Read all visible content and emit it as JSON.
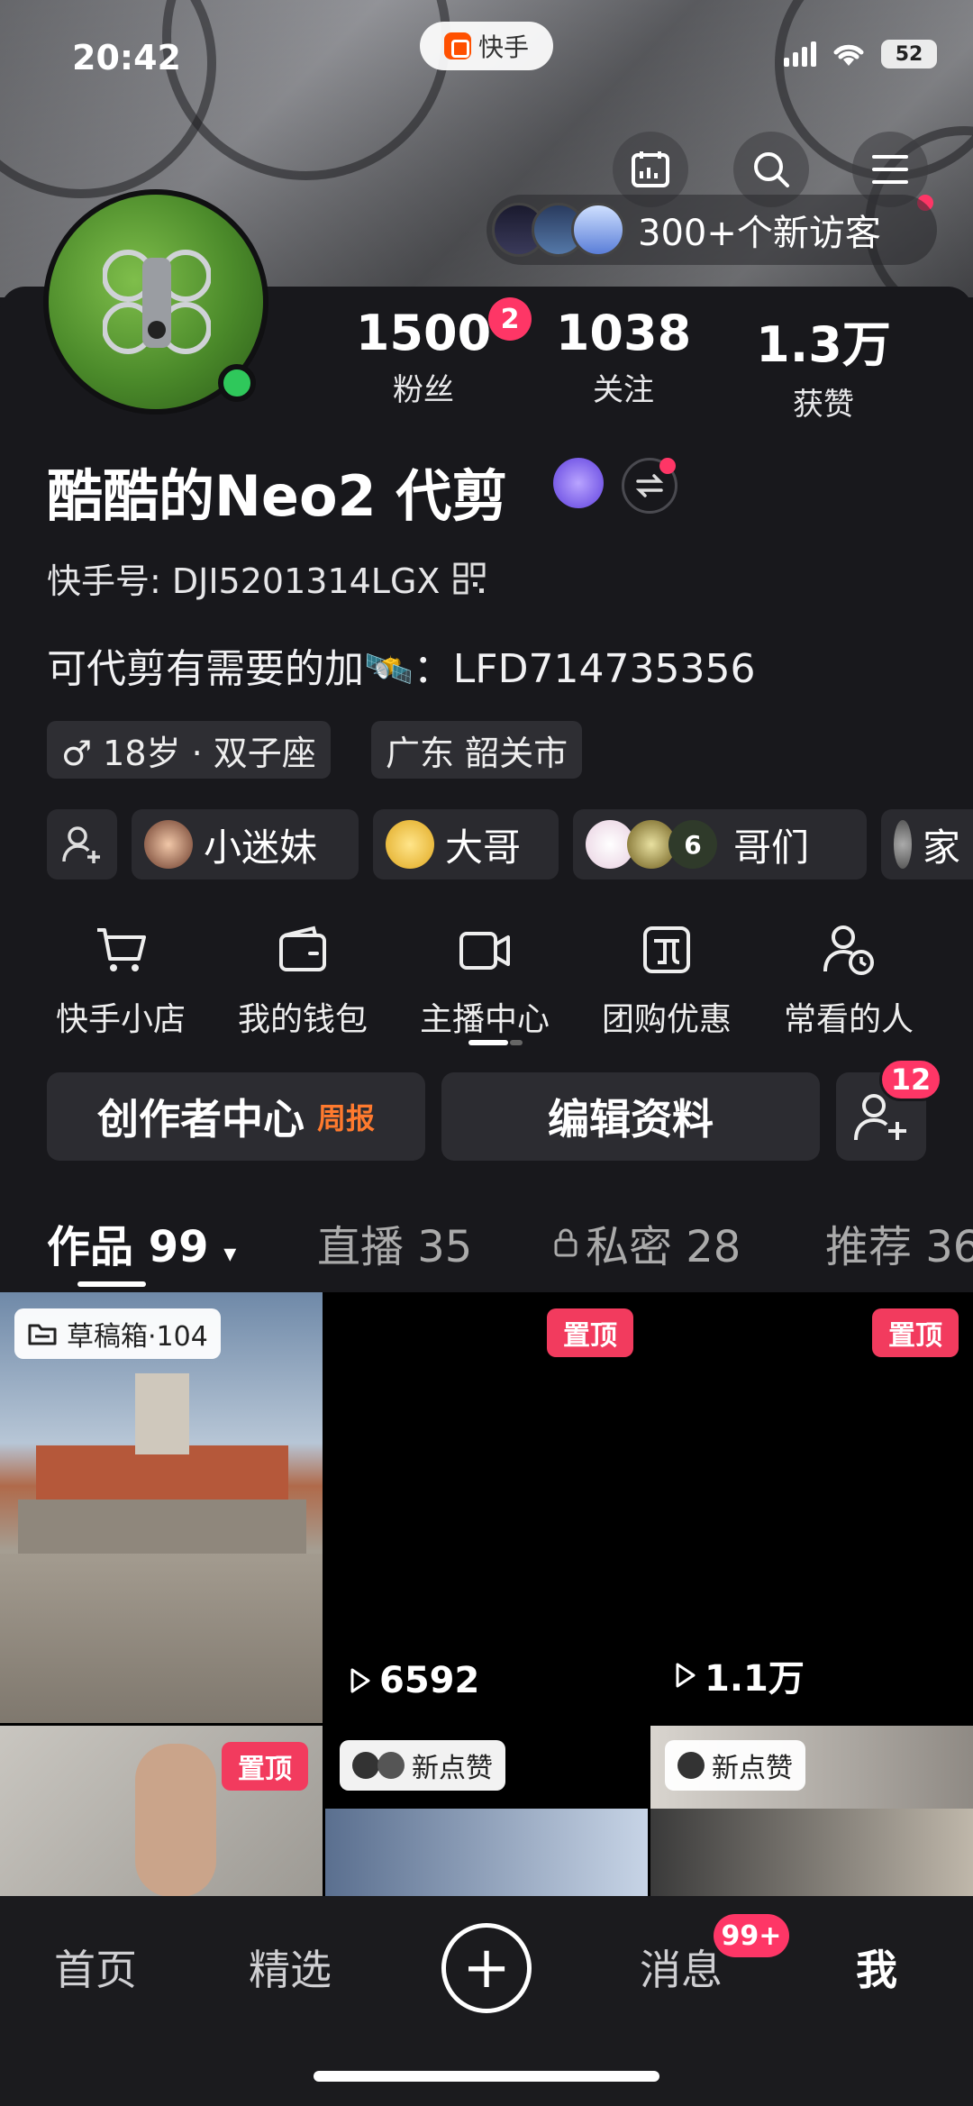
{
  "status_bar": {
    "time": "20:42",
    "app_pill": "快手",
    "battery": "52"
  },
  "header": {
    "visitors_text": "300+个新访客"
  },
  "profile": {
    "stats": [
      {
        "value": "1500",
        "label": "粉丝",
        "badge": "2"
      },
      {
        "value": "1038",
        "label": "关注"
      },
      {
        "value": "1.3万",
        "label": "获赞"
      }
    ],
    "name": "酷酷的Neo2 代剪",
    "kuaishou_id": "快手号: DJI5201314LGX",
    "bio": "可代剪有需要的加🛰️：LFD714735356",
    "tags": [
      "♂ 18岁 · 双子座",
      "广东 韶关市"
    ],
    "friend_chips": [
      {
        "label": "小迷妹"
      },
      {
        "label": "大哥"
      },
      {
        "label": "哥们",
        "count": "6"
      },
      {
        "label": "家"
      }
    ]
  },
  "tools": [
    {
      "label": "快手小店",
      "icon": "cart-icon"
    },
    {
      "label": "我的钱包",
      "icon": "wallet-icon"
    },
    {
      "label": "主播中心",
      "icon": "camera-icon"
    },
    {
      "label": "团购优惠",
      "icon": "coupon-icon"
    },
    {
      "label": "常看的人",
      "icon": "user-clock-icon"
    }
  ],
  "actions": {
    "creator_center": "创作者中心",
    "weekly_report": "周报",
    "edit_profile": "编辑资料",
    "add_friend_badge": "12"
  },
  "tabs": [
    {
      "label": "作品 99"
    },
    {
      "label": "直播 35"
    },
    {
      "label": "私密 28"
    },
    {
      "label": "推荐 36"
    }
  ],
  "grid": {
    "drafts_label": "草稿箱·104",
    "pinned_label": "置顶",
    "new_like_label": "新点赞",
    "views": [
      "6592",
      "1.1万"
    ]
  },
  "bottom_nav": {
    "home": "首页",
    "featured": "精选",
    "messages": "消息",
    "messages_badge": "99+",
    "me": "我"
  },
  "colors": {
    "accent_red": "#fe3666",
    "online_green": "#2fc85b",
    "weekly_orange": "#ff7a2e"
  }
}
